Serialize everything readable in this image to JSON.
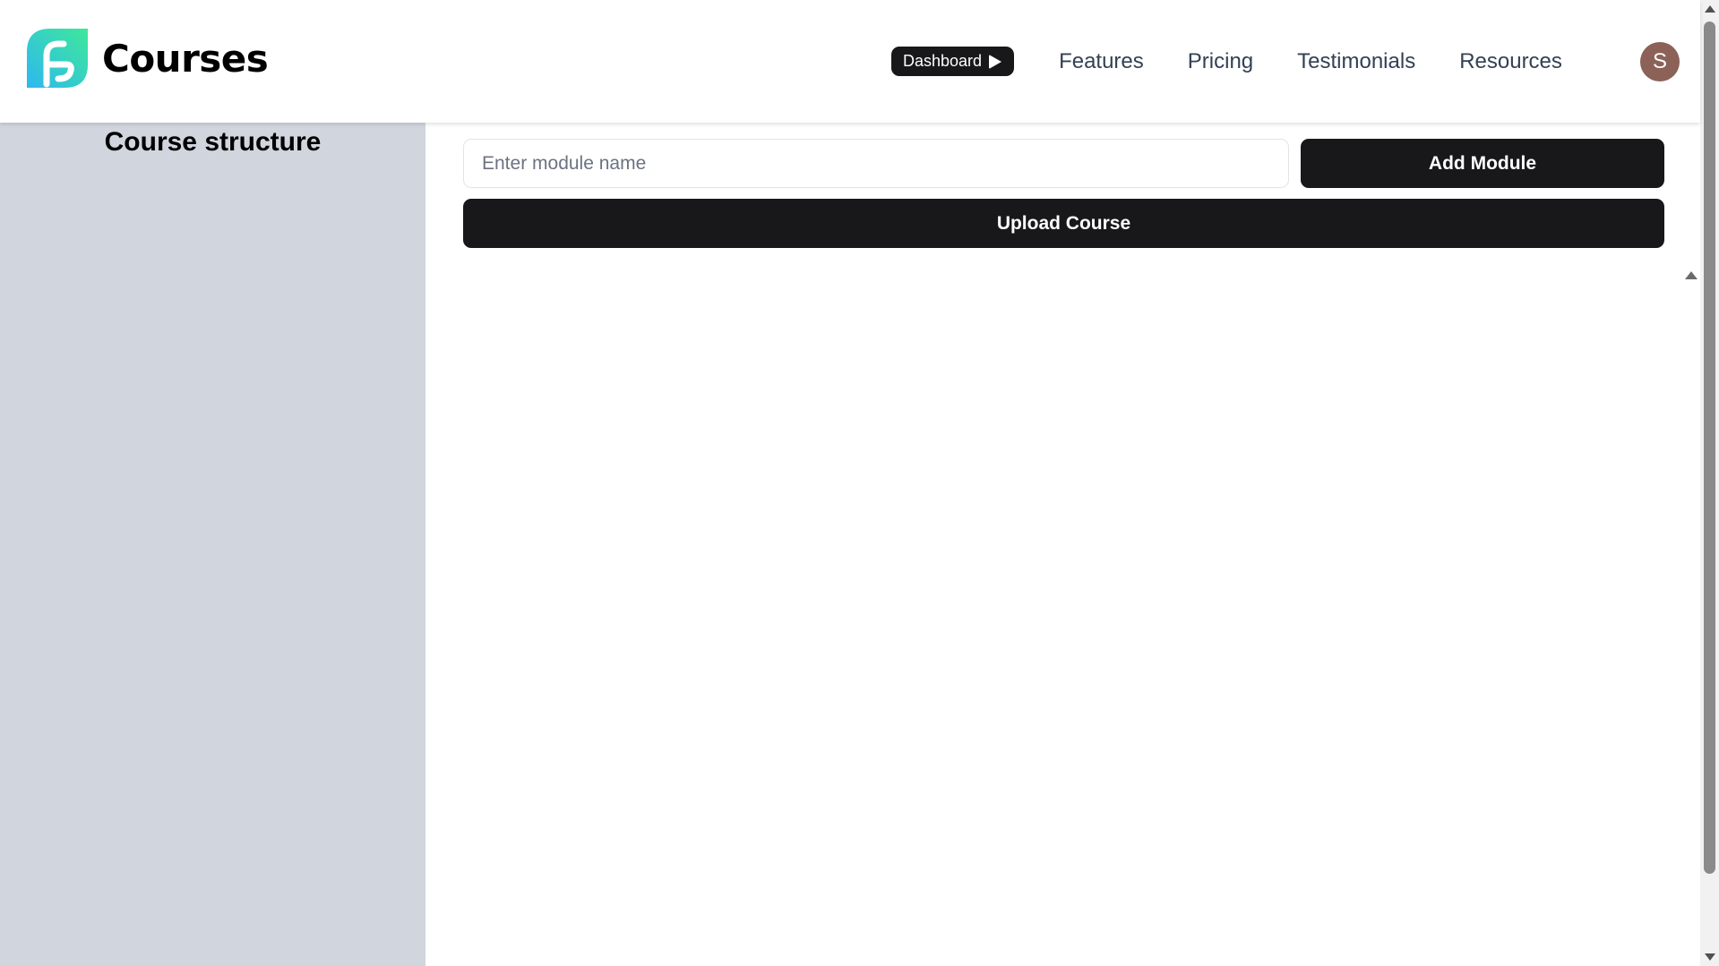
{
  "brand": {
    "name": "Courses",
    "logo_icon": "brand-logo-icon",
    "logo_gradient": [
      "#2eb8f0",
      "#3ee89a"
    ]
  },
  "nav": {
    "dashboard_label": "Dashboard",
    "links": [
      "Features",
      "Pricing",
      "Testimonials",
      "Resources"
    ]
  },
  "user": {
    "avatar_initial": "S",
    "avatar_color": "#8b6158"
  },
  "sidebar": {
    "title": "Course structure",
    "background": "#d1d5dd"
  },
  "main": {
    "module_input": {
      "placeholder": "Enter module name",
      "value": ""
    },
    "add_module_label": "Add Module",
    "upload_course_label": "Upload Course"
  },
  "colors": {
    "button_dark": "#18181b",
    "nav_text": "#334155"
  }
}
